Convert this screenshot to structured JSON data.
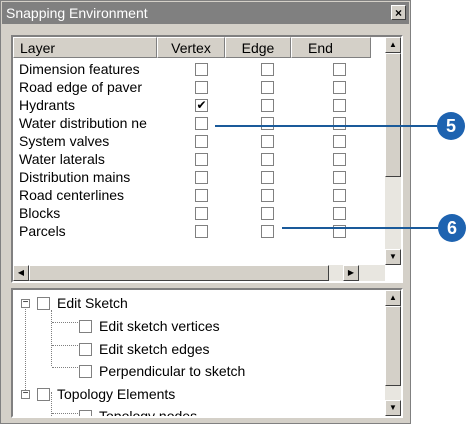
{
  "window": {
    "title": "Snapping Environment",
    "close_glyph": "×"
  },
  "table": {
    "headers": {
      "layer": "Layer",
      "vertex": "Vertex",
      "edge": "Edge",
      "end": "End"
    },
    "rows": [
      {
        "name": "Dimension features",
        "vertex": false,
        "edge": false,
        "end": false
      },
      {
        "name": "Road  edge of paver",
        "vertex": false,
        "edge": false,
        "end": false
      },
      {
        "name": "Hydrants",
        "vertex": true,
        "edge": false,
        "end": false
      },
      {
        "name": "Water distribution ne",
        "vertex": false,
        "edge": false,
        "end": false
      },
      {
        "name": "System valves",
        "vertex": false,
        "edge": false,
        "end": false
      },
      {
        "name": "Water laterals",
        "vertex": false,
        "edge": false,
        "end": false
      },
      {
        "name": "Distribution mains",
        "vertex": false,
        "edge": false,
        "end": false
      },
      {
        "name": "Road centerlines",
        "vertex": false,
        "edge": false,
        "end": false
      },
      {
        "name": "Blocks",
        "vertex": false,
        "edge": false,
        "end": false
      },
      {
        "name": "Parcels",
        "vertex": false,
        "edge": false,
        "end": false
      }
    ],
    "check_glyph": "✔"
  },
  "tree": {
    "nodes": [
      {
        "label": "Edit Sketch",
        "level": 0,
        "expander": "−"
      },
      {
        "label": "Edit sketch vertices",
        "level": 1
      },
      {
        "label": "Edit sketch edges",
        "level": 1
      },
      {
        "label": "Perpendicular to sketch",
        "level": 1
      },
      {
        "label": "Topology Elements",
        "level": 0,
        "expander": "−"
      },
      {
        "label": "Topology nodes",
        "level": 1
      }
    ]
  },
  "scroll_glyphs": {
    "up": "▲",
    "down": "▼",
    "left": "◀",
    "right": "▶"
  },
  "callouts": {
    "first": "5",
    "second": "6"
  },
  "colors": {
    "callout": "#1e63b0",
    "titlebar": "#808080",
    "dialog": "#d4d0c8"
  }
}
